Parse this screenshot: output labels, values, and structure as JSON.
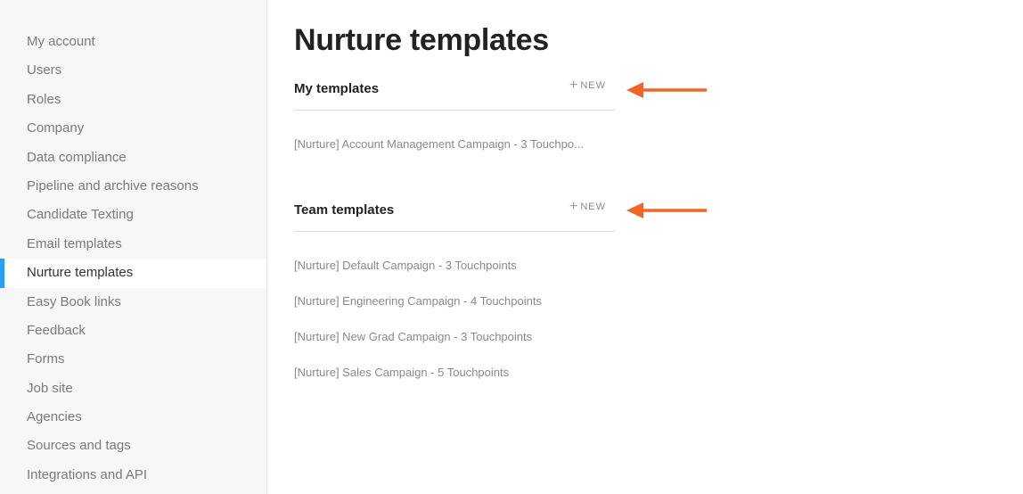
{
  "sidebar": {
    "items": [
      {
        "label": "My account"
      },
      {
        "label": "Users"
      },
      {
        "label": "Roles"
      },
      {
        "label": "Company"
      },
      {
        "label": "Data compliance"
      },
      {
        "label": "Pipeline and archive reasons"
      },
      {
        "label": "Candidate Texting"
      },
      {
        "label": "Email templates"
      },
      {
        "label": "Nurture templates"
      },
      {
        "label": "Easy Book links"
      },
      {
        "label": "Feedback"
      },
      {
        "label": "Forms"
      },
      {
        "label": "Job site"
      },
      {
        "label": "Agencies"
      },
      {
        "label": "Sources and tags"
      },
      {
        "label": "Integrations and API"
      }
    ],
    "active": "Nurture templates",
    "accent_color": "#2a9df4"
  },
  "main": {
    "title": "Nurture templates",
    "my_templates": {
      "title": "My templates",
      "new_label": "NEW",
      "items": [
        "[Nurture] Account Management Campaign - 3 Touchpo..."
      ]
    },
    "team_templates": {
      "title": "Team templates",
      "new_label": "NEW",
      "items": [
        "[Nurture] Default Campaign - 3 Touchpoints",
        "[Nurture] Engineering Campaign - 4 Touchpoints",
        "[Nurture] New Grad Campaign - 3 Touchpoints",
        "[Nurture] Sales Campaign - 5 Touchpoints"
      ]
    }
  },
  "annotation": {
    "arrow_color": "#f26522",
    "icon": "arrow-left-icon"
  }
}
